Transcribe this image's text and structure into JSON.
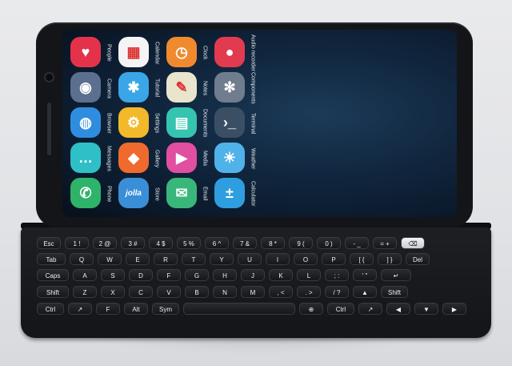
{
  "apps": [
    {
      "label": "People",
      "icon": "heart-icon",
      "color": "#e4324b",
      "glyph": "♥"
    },
    {
      "label": "Calendar",
      "icon": "calendar-icon",
      "color": "#f4f4f6",
      "glyph": "▦"
    },
    {
      "label": "Clock",
      "icon": "clock-icon",
      "color": "#f08a2e",
      "glyph": "◷"
    },
    {
      "label": "Audio recorder",
      "icon": "microphone-icon",
      "color": "#e23b4f",
      "glyph": "●"
    },
    {
      "label": "Camera",
      "icon": "camera-icon",
      "color": "#5b6f8f",
      "glyph": "◉"
    },
    {
      "label": "Tutorial",
      "icon": "tutorial-icon",
      "color": "#3aa6e8",
      "glyph": "✱"
    },
    {
      "label": "Notes",
      "icon": "notes-icon",
      "color": "#e9e4cc",
      "glyph": "✎"
    },
    {
      "label": "Components",
      "icon": "fan-icon",
      "color": "#6f7d8f",
      "glyph": "✻"
    },
    {
      "label": "Browser",
      "icon": "globe-icon",
      "color": "#2f8de0",
      "glyph": "◍"
    },
    {
      "label": "Settings",
      "icon": "gear-icon",
      "color": "#f2b92a",
      "glyph": "⚙"
    },
    {
      "label": "Documents",
      "icon": "documents-icon",
      "color": "#35c4b0",
      "glyph": "▤"
    },
    {
      "label": "Terminal",
      "icon": "terminal-icon",
      "color": "#3a4f64",
      "glyph": "›_"
    },
    {
      "label": "Messages",
      "icon": "messages-icon",
      "color": "#2ec0c6",
      "glyph": "…"
    },
    {
      "label": "Gallery",
      "icon": "gallery-icon",
      "color": "#f06a2e",
      "glyph": "◆"
    },
    {
      "label": "Media",
      "icon": "media-play-icon",
      "color": "#e04fa0",
      "glyph": "▶"
    },
    {
      "label": "Weather",
      "icon": "weather-icon",
      "color": "#4fb3ea",
      "glyph": "☀"
    },
    {
      "label": "Phone",
      "icon": "phone-icon",
      "color": "#2eb36a",
      "glyph": "✆"
    },
    {
      "label": "Store",
      "icon": "store-icon",
      "color": "#3a8ed8",
      "glyph": "jolla"
    },
    {
      "label": "Email",
      "icon": "email-icon",
      "color": "#39b77a",
      "glyph": "✉"
    },
    {
      "label": "Calculator",
      "icon": "calculator-icon",
      "color": "#2f9ee0",
      "glyph": "±"
    }
  ],
  "keyboard": {
    "rows": [
      [
        "Esc",
        "1 !",
        "2 @",
        "3 #",
        "4 $",
        "5 %",
        "6 ^",
        "7 &",
        "8 *",
        "9 (",
        "0 )",
        "- _",
        "= +",
        "⌫"
      ],
      [
        "Tab",
        "Q",
        "W",
        "E",
        "R",
        "T",
        "Y",
        "U",
        "I",
        "O",
        "P",
        "[ {",
        "] }",
        "Del"
      ],
      [
        "Caps",
        "A",
        "S",
        "D",
        "F",
        "G",
        "H",
        "J",
        "K",
        "L",
        "; :",
        "' \"",
        "↵"
      ],
      [
        "Shift",
        "Z",
        "X",
        "C",
        "V",
        "B",
        "N",
        "M",
        ", <",
        ". >",
        "/ ?",
        "▲",
        "Shift"
      ],
      [
        "Ctrl",
        "↗",
        "F",
        "Alt",
        "Sym",
        "",
        "⊕",
        "Ctrl",
        "↗",
        "◀",
        "▼",
        "▶"
      ]
    ]
  }
}
